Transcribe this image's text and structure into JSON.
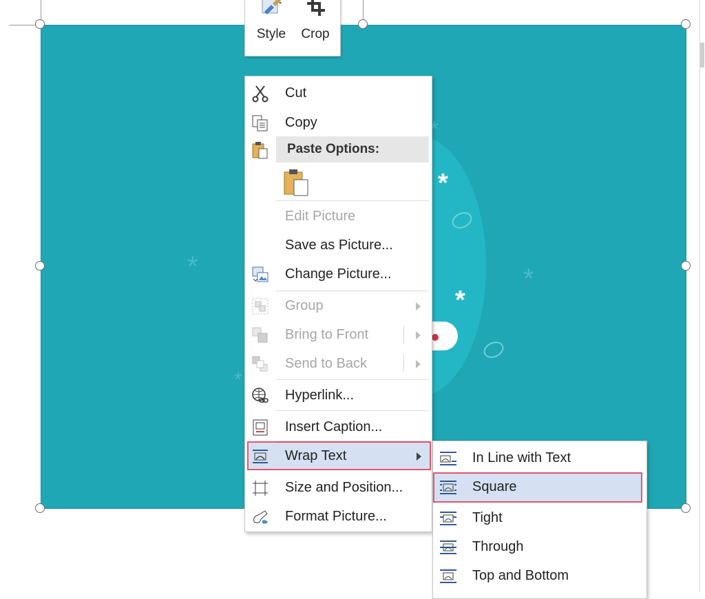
{
  "mini_toolbar": {
    "buttons": [
      {
        "label": "Style",
        "icon": "style-brush-icon"
      },
      {
        "label": "Crop",
        "icon": "crop-icon"
      }
    ]
  },
  "context_menu": {
    "items": [
      {
        "label": "Cut",
        "icon": "scissors-icon",
        "enabled": true
      },
      {
        "label": "Copy",
        "icon": "copy-icon",
        "enabled": true
      },
      {
        "label": "Paste Options:",
        "icon": "paste-icon",
        "type": "header"
      },
      {
        "label": "Edit Picture",
        "enabled": false
      },
      {
        "label": "Save as Picture...",
        "enabled": true
      },
      {
        "label": "Change Picture...",
        "icon": "change-picture-icon",
        "enabled": true
      },
      {
        "label": "Group",
        "icon": "group-icon",
        "enabled": false,
        "submenu": true
      },
      {
        "label": "Bring to Front",
        "icon": "bring-to-front-icon",
        "enabled": false,
        "submenu": true
      },
      {
        "label": "Send to Back",
        "icon": "send-to-back-icon",
        "enabled": false,
        "submenu": true
      },
      {
        "label": "Hyperlink...",
        "icon": "hyperlink-globe-icon",
        "enabled": true
      },
      {
        "label": "Insert Caption...",
        "icon": "insert-caption-icon",
        "enabled": true
      },
      {
        "label": "Wrap Text",
        "icon": "wrap-text-icon",
        "enabled": true,
        "submenu": true,
        "highlighted": true
      },
      {
        "label": "Size and Position...",
        "icon": "size-position-icon",
        "enabled": true
      },
      {
        "label": "Format Picture...",
        "icon": "format-picture-icon",
        "enabled": true
      }
    ]
  },
  "wrap_text_submenu": {
    "items": [
      {
        "label": "In Line with Text",
        "icon": "wrap-inline-icon"
      },
      {
        "label": "Square",
        "icon": "wrap-square-icon",
        "highlighted": true
      },
      {
        "label": "Tight",
        "icon": "wrap-tight-icon"
      },
      {
        "label": "Through",
        "icon": "wrap-through-icon"
      },
      {
        "label": "Top and Bottom",
        "icon": "wrap-top-bottom-icon"
      }
    ]
  },
  "colors": {
    "picture_background": "#1fa7b5",
    "menu_highlight": "#d5e1f2",
    "highlight_border": "#e0556d",
    "disabled_text": "#a6a6a6"
  }
}
